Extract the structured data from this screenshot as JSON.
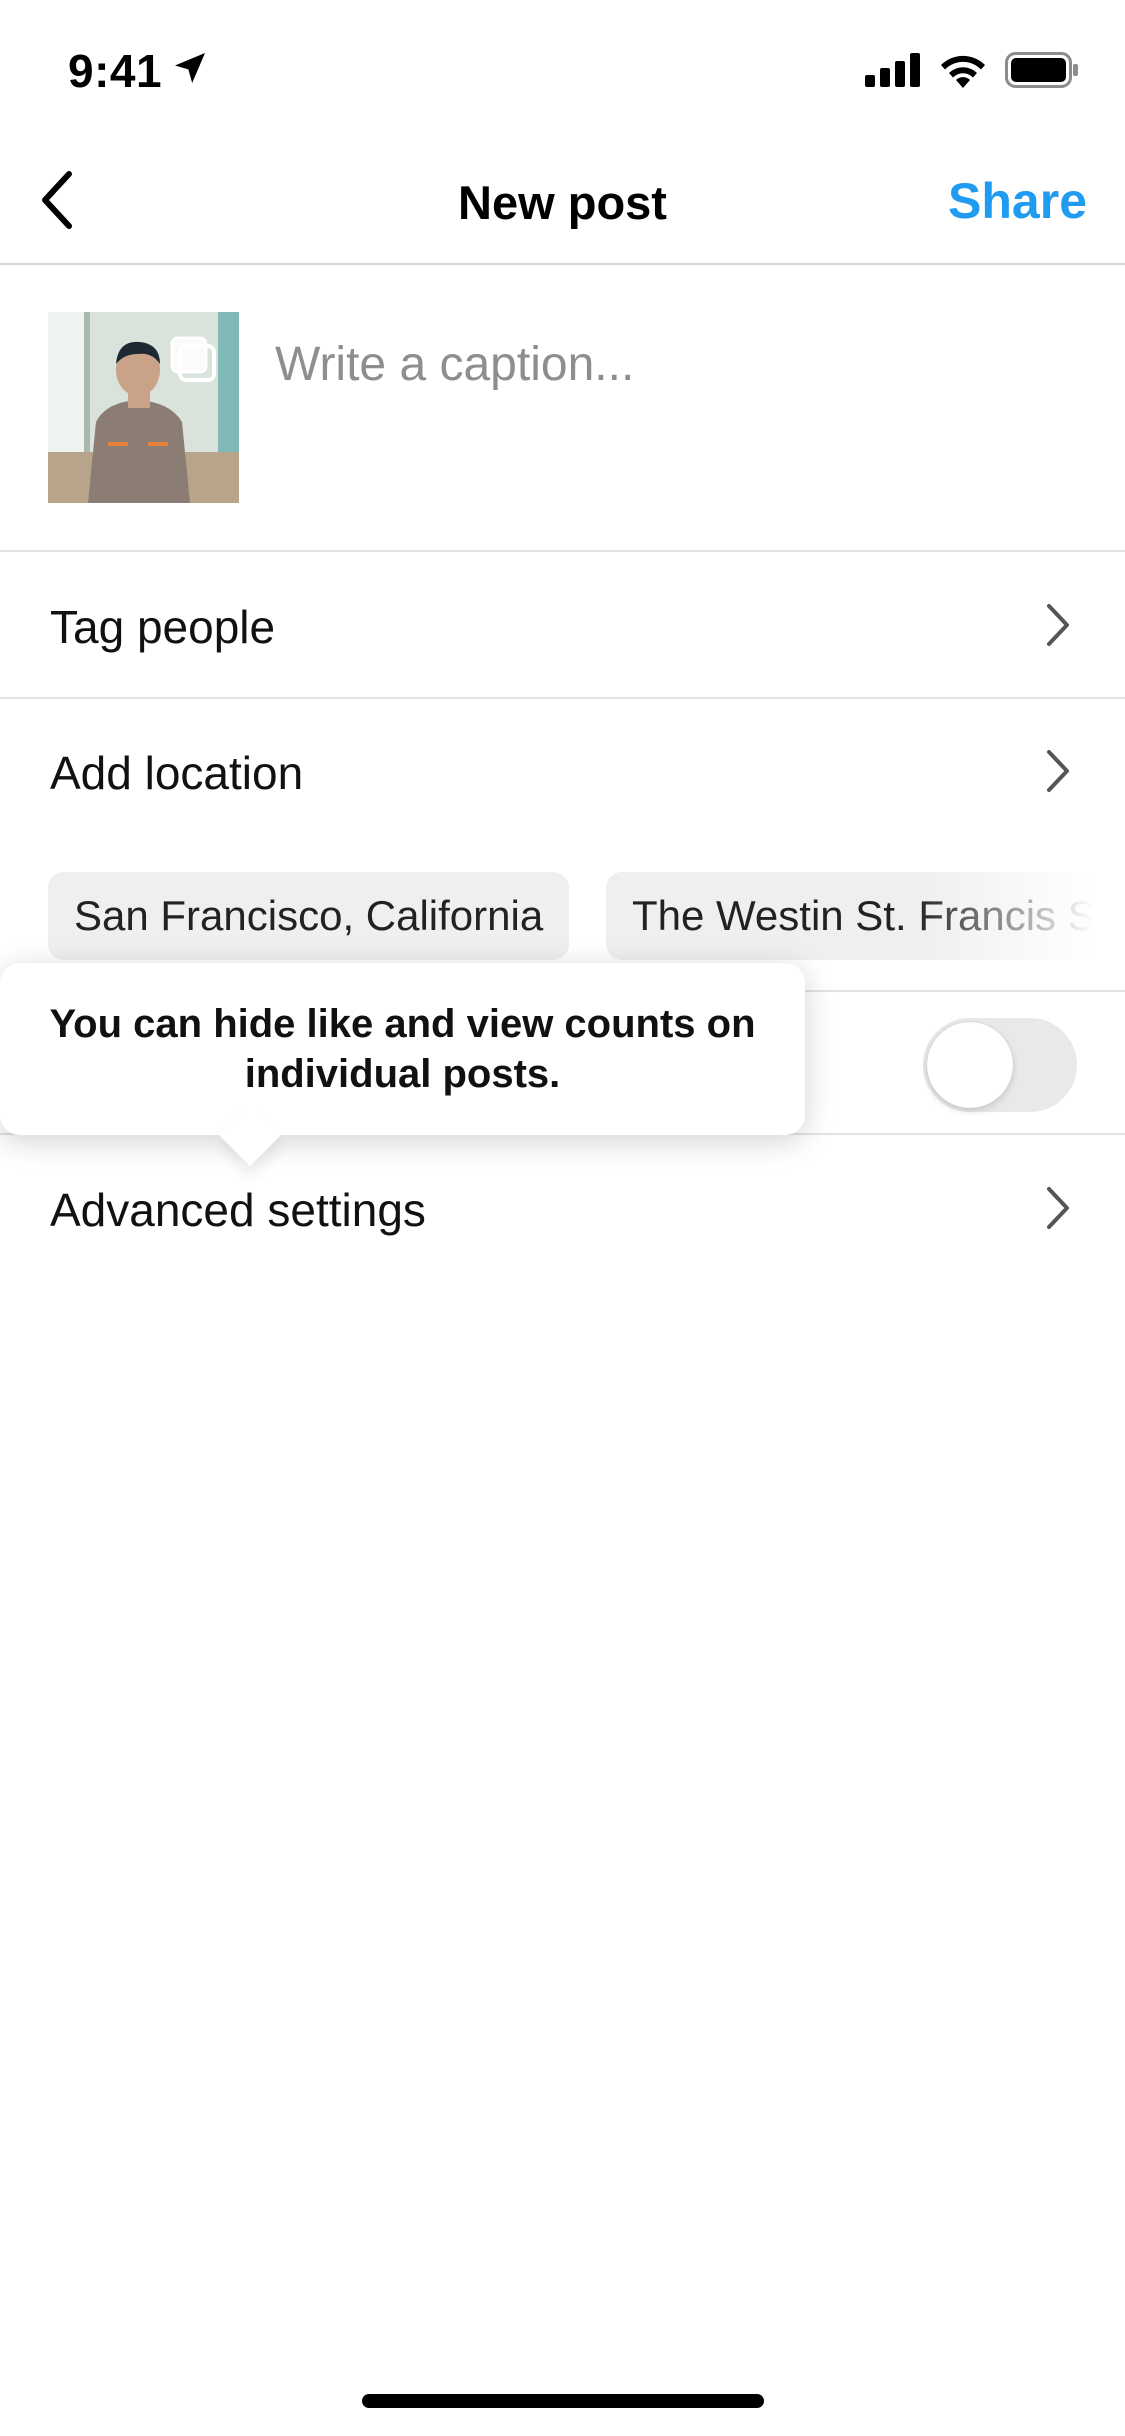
{
  "status_bar": {
    "time": "9:41",
    "icons": [
      "location-arrow-icon",
      "cellular-signal-icon",
      "wifi-icon",
      "battery-icon"
    ]
  },
  "header": {
    "title": "New post",
    "share_label": "Share",
    "back_icon": "chevron-left-icon",
    "accent_color": "#1f9bf0"
  },
  "caption": {
    "placeholder": "Write a caption...",
    "value": ""
  },
  "rows": {
    "tag_people": "Tag people",
    "add_location": "Add location",
    "advanced_settings": "Advanced settings"
  },
  "location_suggestions": [
    "San Francisco, California",
    "The Westin St. Francis Sa"
  ],
  "hide_counts_toggle": {
    "on": false
  },
  "tooltip": {
    "text": "You can hide like and view counts on individual posts."
  }
}
